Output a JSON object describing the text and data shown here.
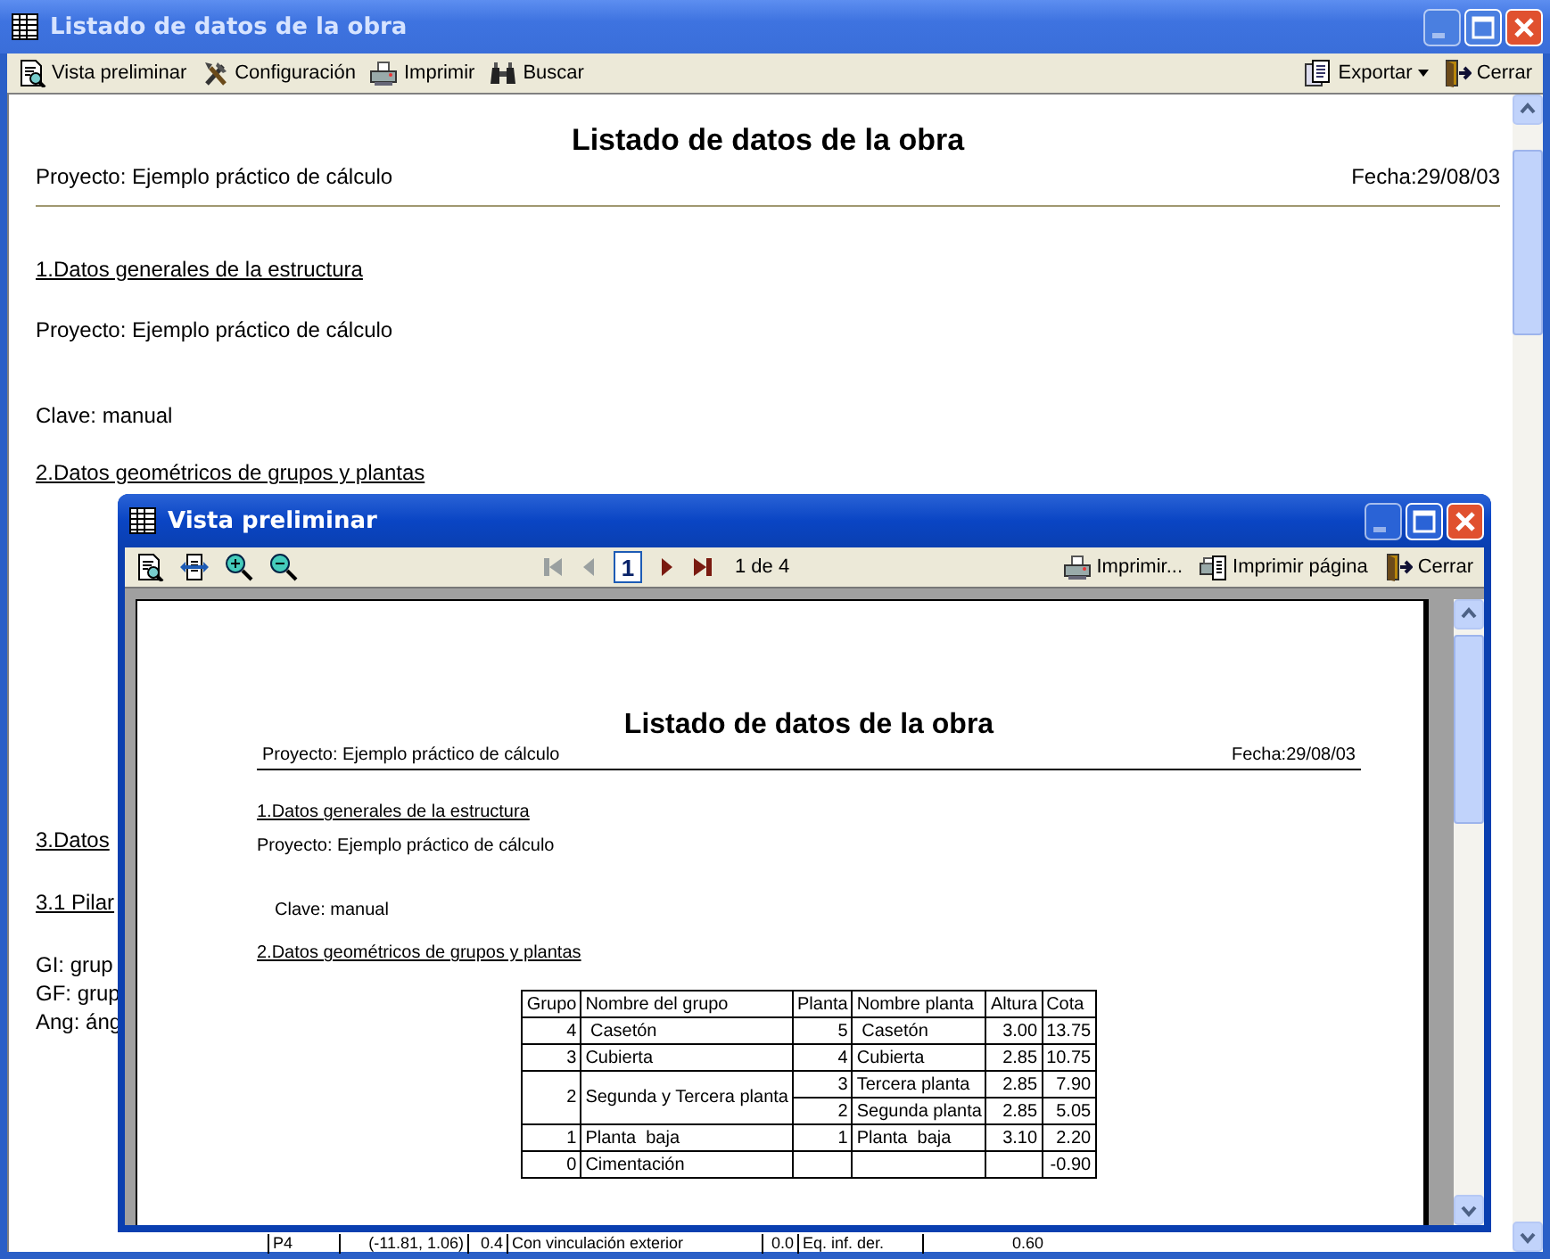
{
  "window": {
    "title": "Listado de datos de la obra"
  },
  "toolbar": {
    "left": [
      {
        "kind": "preview",
        "label": "Vista preliminar"
      },
      {
        "kind": "settings",
        "label": "Configuración"
      },
      {
        "kind": "print",
        "label": "Imprimir"
      },
      {
        "kind": "search",
        "label": "Buscar"
      }
    ],
    "right": [
      {
        "kind": "export",
        "label": "Exportar"
      },
      {
        "kind": "close",
        "label": "Cerrar"
      }
    ]
  },
  "report": {
    "title": "Listado de datos de la obra",
    "project": "Proyecto: Ejemplo práctico de cálculo",
    "date": "Fecha:29/08/03",
    "lines": [
      {
        "kind": "heading",
        "text": "1.Datos generales de la estructura"
      },
      {
        "kind": "text",
        "text": "Proyecto: Ejemplo práctico de cálculo"
      },
      {
        "kind": "text",
        "text": "Clave: manual"
      },
      {
        "kind": "heading",
        "text": "2.Datos geométricos de grupos y plantas"
      },
      {
        "kind": "heading",
        "text": "3.Datos"
      },
      {
        "kind": "heading",
        "text": "3.1 Pilar"
      },
      {
        "kind": "text",
        "text": "GI: grup"
      },
      {
        "kind": "text",
        "text": "GF: grup"
      },
      {
        "kind": "text",
        "text": "Ang: áng"
      }
    ]
  },
  "preview": {
    "title": "Vista preliminar",
    "nav": [
      {
        "kind": "first",
        "disabled": true
      },
      {
        "kind": "prev",
        "disabled": true
      },
      {
        "kind": "next",
        "disabled": false
      },
      {
        "kind": "last",
        "disabled": false
      }
    ],
    "page_field": "1",
    "page_count": "1 de 4",
    "actions": [
      {
        "kind": "print",
        "label": "Imprimir..."
      },
      {
        "kind": "print-page",
        "label": "Imprimir página"
      },
      {
        "kind": "close",
        "label": "Cerrar"
      }
    ],
    "page": {
      "title": "Listado de datos de la obra",
      "project": "Proyecto:  Ejemplo práctico de cálculo",
      "date": "Fecha:29/08/03",
      "lines": [
        {
          "kind": "heading",
          "text": "1.Datos generales de la estructura"
        },
        {
          "kind": "text",
          "text": "Proyecto: Ejemplo práctico de cálculo"
        },
        {
          "kind": "indented",
          "text": "Clave: manual"
        },
        {
          "kind": "heading",
          "text": "2.Datos geométricos de grupos y plantas"
        }
      ],
      "table": {
        "columns": [
          "Grupo",
          "Nombre del grupo",
          "Planta",
          "Nombre planta",
          "Altura",
          "Cota"
        ],
        "groups": [
          {
            "grupo": "4",
            "nombre": " Casetón",
            "plantas": [
              {
                "planta": "5",
                "nombre": " Casetón",
                "altura": "3.00",
                "cota": "13.75"
              }
            ]
          },
          {
            "grupo": "3",
            "nombre": "Cubierta",
            "plantas": [
              {
                "planta": "4",
                "nombre": "Cubierta",
                "altura": "2.85",
                "cota": "10.75"
              }
            ]
          },
          {
            "grupo": "2",
            "nombre": "Segunda y Tercera planta",
            "plantas": [
              {
                "planta": "3",
                "nombre": "Tercera planta",
                "altura": "2.85",
                "cota": "7.90"
              },
              {
                "planta": "2",
                "nombre": "Segunda planta",
                "altura": "2.85",
                "cota": "5.05"
              }
            ]
          },
          {
            "grupo": "1",
            "nombre": "Planta  baja",
            "plantas": [
              {
                "planta": "1",
                "nombre": "Planta  baja",
                "altura": "3.10",
                "cota": "2.20"
              }
            ]
          },
          {
            "grupo": "0",
            "nombre": "Cimentación",
            "plantas": [
              {
                "cota": "-0.90"
              }
            ]
          }
        ]
      }
    }
  },
  "cut_row": [
    "P4",
    "(-11.81, 1.06)",
    "0.4",
    "Con vinculación exterior",
    "0.0",
    "Eq. inf. der.",
    "0.60"
  ]
}
